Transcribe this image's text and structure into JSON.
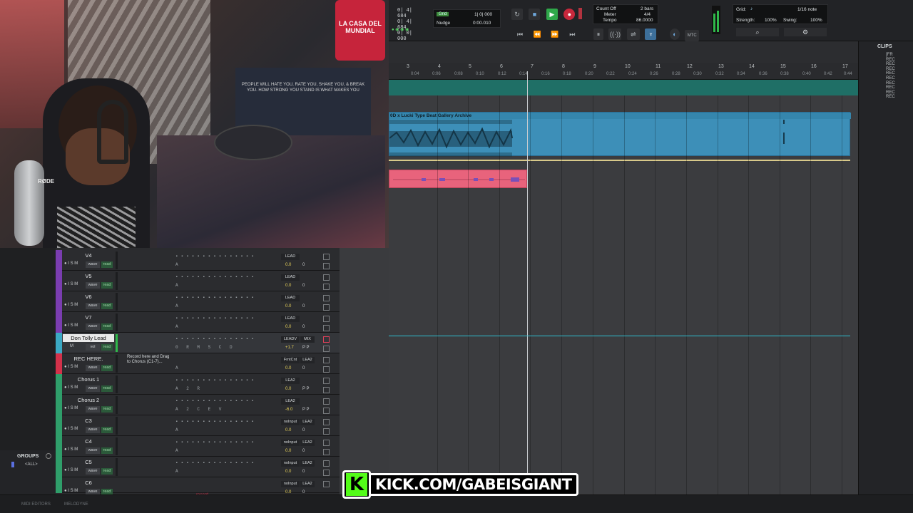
{
  "transport": {
    "counter_lines": [
      "0| 4| 684",
      "0| 4| 684",
      "0| 0| 000"
    ],
    "grid_label": "Grid",
    "grid_value": "1| 0| 000",
    "nudge_label": "Nudge",
    "nudge_value": "0:00.010",
    "count_off_label": "Count Off",
    "count_off_value": "2 bars",
    "meter_label": "Meter",
    "meter_value": "4/4",
    "tempo_label": "Tempo",
    "tempo_value": "86.0000",
    "mtc_label": "MTC",
    "grid_setting_label": "Grid:",
    "grid_setting_value": "1/16 note",
    "strength_label": "Strength:",
    "strength_value": "100%",
    "swing_label": "Swing:",
    "swing_value": "100%"
  },
  "clips_panel": {
    "title": "CLIPS",
    "items": [
      "[FR",
      "REC",
      "REC",
      "REC",
      "REC",
      "REC",
      "REC",
      "REC",
      "REC",
      "REC"
    ]
  },
  "ruler": {
    "bars": [
      "3",
      "4",
      "5",
      "6",
      "7",
      "8",
      "9",
      "10",
      "11",
      "12",
      "13",
      "14",
      "15",
      "16",
      "17"
    ],
    "times": [
      "0:04",
      "0:06",
      "0:08",
      "0:10",
      "0:12",
      "0:14",
      "0:16",
      "0:18",
      "0:20",
      "0:22",
      "0:24",
      "0:26",
      "0:28",
      "0:30",
      "0:32",
      "0:34",
      "0:36",
      "0:38",
      "0:40",
      "0:42",
      "0:44"
    ]
  },
  "audio_clip": {
    "name": "0D x Lucki Type Beat Gallery Archive",
    "color": "#3d8fb8"
  },
  "pink_clip_color": "#e8637c",
  "tracks": [
    {
      "name": "V4",
      "color": "#7a3db0",
      "io1": "LEAD",
      "vol": "0.0",
      "pan": "0"
    },
    {
      "name": "V5",
      "color": "#7a3db0",
      "io1": "LEAD",
      "vol": "0.0",
      "pan": "0"
    },
    {
      "name": "V6",
      "color": "#7a3db0",
      "io1": "LEAD",
      "vol": "0.0",
      "pan": "0"
    },
    {
      "name": "V7",
      "color": "#7a3db0",
      "io1": "LEAD",
      "vol": "0.0",
      "pan": "0"
    },
    {
      "name": "Don Tolly Lead",
      "color": "#3ba9c4",
      "io1": "LEADV",
      "io2": "MIX",
      "vol": "+1.7",
      "pan": "P P",
      "highlight": true
    },
    {
      "name": "REC HERE.",
      "color": "#d3314a",
      "io1": "FrntCnt",
      "io2": "LEA2",
      "vol": "0.0",
      "pan": "0"
    },
    {
      "name": "Chorus 1",
      "color": "#2f9e6a",
      "io1": "LEA2",
      "vol": "0.0",
      "pan": "P P"
    },
    {
      "name": "Chorus 2",
      "color": "#2f9e6a",
      "io1": "LEA2",
      "vol": "-6.0",
      "pan": "P P"
    },
    {
      "name": "C3",
      "color": "#2f9e6a",
      "io1": "noInput",
      "io2": "LEA2",
      "vol": "0.0",
      "pan": "0"
    },
    {
      "name": "C4",
      "color": "#2f9e6a",
      "io1": "noInput",
      "io2": "LEA2",
      "vol": "0.0",
      "pan": "0"
    },
    {
      "name": "C5",
      "color": "#2f9e6a",
      "io1": "noInput",
      "io2": "LEA2",
      "vol": "0.0",
      "pan": "0"
    },
    {
      "name": "C6",
      "color": "#2f9e6a",
      "io1": "noInput",
      "io2": "LEA2",
      "vol": "0.0",
      "pan": "0"
    }
  ],
  "track_controls": {
    "i": "I",
    "s": "S",
    "m": "M",
    "wave": "wave",
    "read": "read",
    "vol_label": "vol"
  },
  "rec_note": "Record here and Drag to Chorus (C1-7)...",
  "record_label": "record",
  "groups": {
    "title": "GROUPS",
    "all": "<ALL>"
  },
  "bottom_tabs": [
    "MIDI EDITORS",
    "MELODYNE"
  ],
  "stream_banner": {
    "text": "KICK.COM/GABEISGIANT",
    "logo": "K",
    "brand_color": "#53fc18"
  },
  "webcam_signs": [
    "LA CASA DEL MUNDIAL",
    "PEOPLE WILL HATE YOU, RATE YOU, SHAKE YOU, & BREAK YOU. HOW STRONG YOU STAND IS WHAT MAKES YOU",
    "RØDE"
  ]
}
